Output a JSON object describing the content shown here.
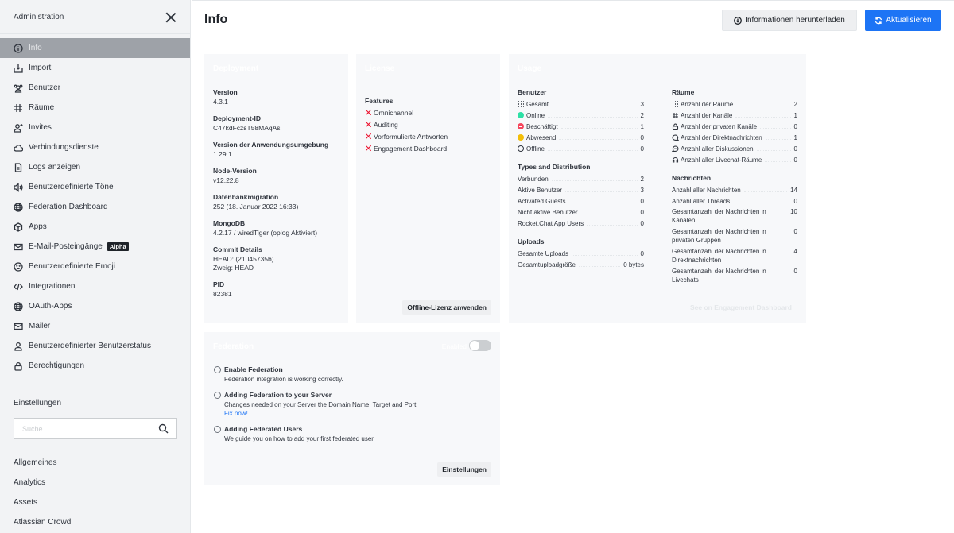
{
  "sidebar": {
    "title": "Administration",
    "items": [
      {
        "label": "Info",
        "icon": "info-icon",
        "active": true
      },
      {
        "label": "Import",
        "icon": "import-icon"
      },
      {
        "label": "Benutzer",
        "icon": "team-icon"
      },
      {
        "label": "Räume",
        "icon": "hashtag-icon"
      },
      {
        "label": "Invites",
        "icon": "user-plus-icon"
      },
      {
        "label": "Verbindungsdienste",
        "icon": "cloud-icon"
      },
      {
        "label": "Logs anzeigen",
        "icon": "document-icon"
      },
      {
        "label": "Benutzerdefinierte Töne",
        "icon": "speaker-icon"
      },
      {
        "label": "Federation Dashboard",
        "icon": "globe-icon"
      },
      {
        "label": "Apps",
        "icon": "cube-icon"
      },
      {
        "label": "E-Mail-Posteingänge",
        "icon": "mail-icon",
        "badge": "Alpha"
      },
      {
        "label": "Benutzerdefinierte Emoji",
        "icon": "emoji-icon"
      },
      {
        "label": "Integrationen",
        "icon": "code-icon"
      },
      {
        "label": "OAuth-Apps",
        "icon": "globe-icon"
      },
      {
        "label": "Mailer",
        "icon": "mail-icon"
      },
      {
        "label": "Benutzerdefinierter Benutzerstatus",
        "icon": "user-icon"
      },
      {
        "label": "Berechtigungen",
        "icon": "lock-icon"
      }
    ],
    "settings_title": "Einstellungen",
    "search_placeholder": "Suche",
    "settings_items": [
      "Allgemeines",
      "Analytics",
      "Assets",
      "Atlassian Crowd"
    ]
  },
  "header": {
    "title": "Info",
    "download_label": "Informationen herunterladen",
    "refresh_label": "Aktualisieren"
  },
  "deployment": {
    "title": "Deployment",
    "fields": [
      {
        "label": "Version",
        "value": "4.3.1"
      },
      {
        "label": "Deployment-ID",
        "value": "C47kdFczsT58MAqAs"
      },
      {
        "label": "Version der Anwendungsumgebung",
        "value": "1.29.1"
      },
      {
        "label": "Node-Version",
        "value": "v12.22.8"
      },
      {
        "label": "Datenbankmigration",
        "value": "252 (18. Januar 2022 16:33)"
      },
      {
        "label": "MongoDB",
        "value": "4.2.17 / wiredTiger (oplog Aktiviert)"
      },
      {
        "label": "Commit Details",
        "value": "HEAD: (21045735b)",
        "value2": "Zweig: HEAD"
      },
      {
        "label": "PID",
        "value": "82381"
      }
    ]
  },
  "license": {
    "title": "License",
    "features_title": "Features",
    "features": [
      "Omnichannel",
      "Auditing",
      "Vorformulierte Antworten",
      "Engagement Dashboard"
    ],
    "apply_button": "Offline-Lizenz anwenden"
  },
  "usage": {
    "title": "Usage",
    "users": {
      "title": "Benutzer",
      "rows": [
        {
          "label": "Gesamt",
          "value": "3"
        },
        {
          "label": "Online",
          "value": "2"
        },
        {
          "label": "Beschäftigt",
          "value": "1"
        },
        {
          "label": "Abwesend",
          "value": "0"
        },
        {
          "label": "Offline",
          "value": "0"
        }
      ]
    },
    "types": {
      "title": "Types and Distribution",
      "rows": [
        {
          "label": "Verbunden",
          "value": "2"
        },
        {
          "label": "Aktive Benutzer",
          "value": "3"
        },
        {
          "label": "Activated Guests",
          "value": "0"
        },
        {
          "label": "Nicht aktive Benutzer",
          "value": "0"
        },
        {
          "label": "Rocket.Chat App Users",
          "value": "0"
        }
      ]
    },
    "uploads": {
      "title": "Uploads",
      "rows": [
        {
          "label": "Gesamte Uploads",
          "value": "0"
        },
        {
          "label": "Gesamtuploadgröße",
          "value": "0 bytes"
        }
      ]
    },
    "rooms": {
      "title": "Räume",
      "rows": [
        {
          "label": "Anzahl der Räume",
          "value": "2"
        },
        {
          "label": "Anzahl der Kanäle",
          "value": "1"
        },
        {
          "label": "Anzahl der privaten Kanäle",
          "value": "0"
        },
        {
          "label": "Anzahl der Direktnachrichten",
          "value": "1"
        },
        {
          "label": "Anzahl aller Diskussionen",
          "value": "0"
        },
        {
          "label": "Anzahl aller Livechat-Räume",
          "value": "0"
        }
      ]
    },
    "messages": {
      "title": "Nachrichten",
      "rows": [
        {
          "label": "Anzahl aller Nachrichten",
          "value": "14"
        },
        {
          "label": "Anzahl aller Threads",
          "value": "0"
        },
        {
          "label": "Gesamtanzahl der Nachrichten in Kanälen",
          "value": "10"
        },
        {
          "label": "Gesamtanzahl der Nachrichten in privaten Gruppen",
          "value": "0"
        },
        {
          "label": "Gesamtanzahl der Nachrichten in Direktnachrichten",
          "value": "4"
        },
        {
          "label": "Gesamtanzahl der Nachrichten in Livechats",
          "value": "0"
        }
      ]
    },
    "engagement_link": "See on Engagement Dashboard"
  },
  "federation": {
    "title": "Federation",
    "toggle_label": "Enabled",
    "toggle_on": false,
    "steps": [
      {
        "title": "Enable Federation",
        "desc": "Federation integration is working correctly."
      },
      {
        "title": "Adding Federation to your Server",
        "desc": "Changes needed on your Server the Domain Name, Target and Port.",
        "link": "Fix now!"
      },
      {
        "title": "Adding Federated Users",
        "desc": "We guide you on how to add your first federated user."
      }
    ],
    "settings_button": "Einstellungen"
  },
  "colors": {
    "primary": "#1d74f5",
    "online": "#2de0a5",
    "busy": "#f5455c",
    "away": "#ffd21f",
    "feature_disabled": "#ec0d2a",
    "link": "#1d74f5"
  }
}
